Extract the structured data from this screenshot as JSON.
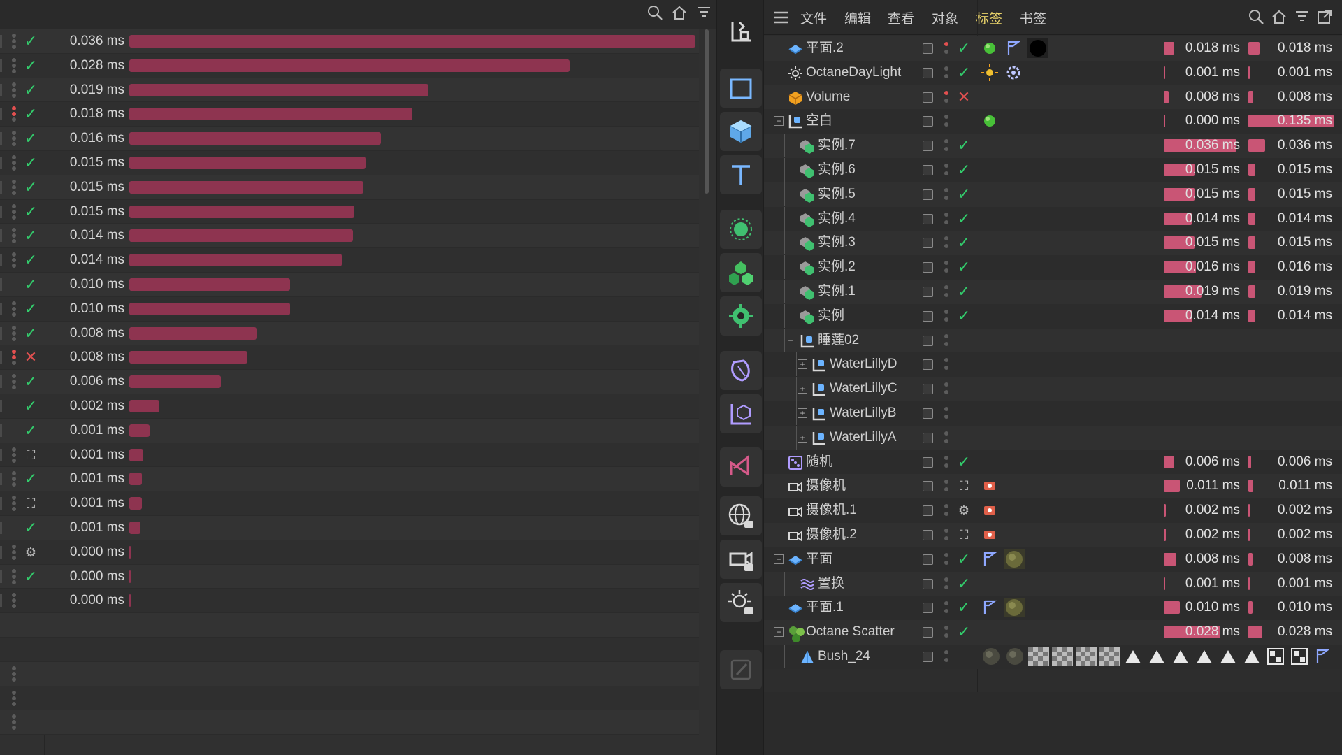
{
  "left": {
    "rows": [
      {
        "ms": "0.036 ms",
        "v": 0.036,
        "status": "check",
        "dots": "normal"
      },
      {
        "ms": "0.028 ms",
        "v": 0.028,
        "status": "check",
        "dots": "normal"
      },
      {
        "ms": "0.019 ms",
        "v": 0.019,
        "status": "check",
        "dots": "normal"
      },
      {
        "ms": "0.018 ms",
        "v": 0.018,
        "status": "check",
        "dots": "red"
      },
      {
        "ms": "0.016 ms",
        "v": 0.016,
        "status": "check",
        "dots": "normal"
      },
      {
        "ms": "0.015 ms",
        "v": 0.015,
        "status": "check",
        "dots": "normal"
      },
      {
        "ms": "0.015 ms",
        "v": 0.0149,
        "status": "check",
        "dots": "normal"
      },
      {
        "ms": "0.015 ms",
        "v": 0.0143,
        "status": "check",
        "dots": "normal"
      },
      {
        "ms": "0.014 ms",
        "v": 0.0142,
        "status": "check",
        "dots": "normal"
      },
      {
        "ms": "0.014 ms",
        "v": 0.0135,
        "status": "check",
        "dots": "normal"
      },
      {
        "ms": "0.010 ms",
        "v": 0.0102,
        "status": "check",
        "dots": "none"
      },
      {
        "ms": "0.010 ms",
        "v": 0.0102,
        "status": "check",
        "dots": "normal"
      },
      {
        "ms": "0.008 ms",
        "v": 0.0081,
        "status": "check",
        "dots": "normal"
      },
      {
        "ms": "0.008 ms",
        "v": 0.0075,
        "status": "x",
        "dots": "red"
      },
      {
        "ms": "0.006 ms",
        "v": 0.0058,
        "status": "check",
        "dots": "normal"
      },
      {
        "ms": "0.002 ms",
        "v": 0.0019,
        "status": "check",
        "dots": "none"
      },
      {
        "ms": "0.001 ms",
        "v": 0.0013,
        "status": "check",
        "dots": "none"
      },
      {
        "ms": "0.001 ms",
        "v": 0.0009,
        "status": "box",
        "dots": "normal"
      },
      {
        "ms": "0.001 ms",
        "v": 0.0008,
        "status": "check",
        "dots": "normal"
      },
      {
        "ms": "0.001 ms",
        "v": 0.0008,
        "status": "box",
        "dots": "normal"
      },
      {
        "ms": "0.001 ms",
        "v": 0.0007,
        "status": "check",
        "dots": "none"
      },
      {
        "ms": "0.000 ms",
        "v": 0.0001,
        "status": "gear",
        "dots": "normal"
      },
      {
        "ms": "0.000 ms",
        "v": 5e-05,
        "status": "check",
        "dots": "normal"
      },
      {
        "ms": "0.000 ms",
        "v": 3e-05,
        "status": "none",
        "dots": "normal"
      }
    ],
    "max": 0.036
  },
  "menu": {
    "file": "文件",
    "edit": "编辑",
    "view": "查看",
    "object": "对象",
    "tags": "标签",
    "bookmarks": "书签"
  },
  "objects": [
    {
      "name": "平面.2",
      "indent": 0,
      "exp": "",
      "icon": "plane",
      "vis": "red",
      "stat": "check",
      "tags": "green,flag,black",
      "t1": "0.018 ms",
      "f1": 0.133,
      "t2": "0.018 ms",
      "f2": 0.133
    },
    {
      "name": "OctaneDayLight",
      "indent": 0,
      "exp": "",
      "icon": "sun",
      "vis": "normal",
      "stat": "check",
      "tags": "sun,gear",
      "t1": "0.001 ms",
      "f1": 0.0,
      "t2": "0.001 ms",
      "f2": 0.0
    },
    {
      "name": "Volume",
      "indent": 0,
      "exp": "",
      "icon": "volume",
      "vis": "red",
      "stat": "x",
      "tags": "",
      "t1": "0.008 ms",
      "f1": 0.06,
      "t2": "0.008 ms",
      "f2": 0.06
    },
    {
      "name": "空白",
      "indent": 0,
      "exp": "-",
      "icon": "null",
      "vis": "normal",
      "stat": "none",
      "tags": "green",
      "t1": "0.000 ms",
      "f1": 0.0,
      "t2": "0.135 ms",
      "f2": 1.0
    },
    {
      "name": "实例.7",
      "indent": 1,
      "exp": "",
      "icon": "instance",
      "vis": "normal",
      "stat": "check",
      "tags": "",
      "t1": "0.036 ms",
      "f1": 0.9,
      "t2": "0.036 ms",
      "f2": 0.2
    },
    {
      "name": "实例.6",
      "indent": 1,
      "exp": "",
      "icon": "instance",
      "vis": "normal",
      "stat": "check",
      "tags": "",
      "t1": "0.015 ms",
      "f1": 0.38,
      "t2": "0.015 ms",
      "f2": 0.08
    },
    {
      "name": "实例.5",
      "indent": 1,
      "exp": "",
      "icon": "instance",
      "vis": "normal",
      "stat": "check",
      "tags": "",
      "t1": "0.015 ms",
      "f1": 0.38,
      "t2": "0.015 ms",
      "f2": 0.08
    },
    {
      "name": "实例.4",
      "indent": 1,
      "exp": "",
      "icon": "instance",
      "vis": "normal",
      "stat": "check",
      "tags": "",
      "t1": "0.014 ms",
      "f1": 0.35,
      "t2": "0.014 ms",
      "f2": 0.08
    },
    {
      "name": "实例.3",
      "indent": 1,
      "exp": "",
      "icon": "instance",
      "vis": "normal",
      "stat": "check",
      "tags": "",
      "t1": "0.015 ms",
      "f1": 0.38,
      "t2": "0.015 ms",
      "f2": 0.08
    },
    {
      "name": "实例.2",
      "indent": 1,
      "exp": "",
      "icon": "instance",
      "vis": "normal",
      "stat": "check",
      "tags": "",
      "t1": "0.016 ms",
      "f1": 0.4,
      "t2": "0.016 ms",
      "f2": 0.08
    },
    {
      "name": "实例.1",
      "indent": 1,
      "exp": "",
      "icon": "instance",
      "vis": "normal",
      "stat": "check",
      "tags": "",
      "t1": "0.019 ms",
      "f1": 0.47,
      "t2": "0.019 ms",
      "f2": 0.08
    },
    {
      "name": "实例",
      "indent": 1,
      "exp": "",
      "icon": "instance",
      "vis": "normal",
      "stat": "check",
      "tags": "",
      "t1": "0.014 ms",
      "f1": 0.35,
      "t2": "0.014 ms",
      "f2": 0.08
    },
    {
      "name": "睡莲02",
      "indent": 1,
      "exp": "-",
      "icon": "null",
      "vis": "normal",
      "stat": "none",
      "tags": "",
      "t1": "",
      "f1": 0,
      "t2": "",
      "f2": 0
    },
    {
      "name": "WaterLillyD",
      "indent": 2,
      "exp": "+",
      "icon": "null",
      "vis": "normal",
      "stat": "none",
      "tags": "",
      "t1": "",
      "f1": 0,
      "t2": "",
      "f2": 0
    },
    {
      "name": "WaterLillyC",
      "indent": 2,
      "exp": "+",
      "icon": "null",
      "vis": "normal",
      "stat": "none",
      "tags": "",
      "t1": "",
      "f1": 0,
      "t2": "",
      "f2": 0
    },
    {
      "name": "WaterLillyB",
      "indent": 2,
      "exp": "+",
      "icon": "null",
      "vis": "normal",
      "stat": "none",
      "tags": "",
      "t1": "",
      "f1": 0,
      "t2": "",
      "f2": 0
    },
    {
      "name": "WaterLillyA",
      "indent": 2,
      "exp": "+",
      "icon": "null",
      "vis": "normal",
      "stat": "none",
      "tags": "",
      "t1": "",
      "f1": 0,
      "t2": "",
      "f2": 0
    },
    {
      "name": "随机",
      "indent": 0,
      "exp": "",
      "icon": "random",
      "vis": "normal",
      "stat": "check",
      "tags": "",
      "t1": "0.006 ms",
      "f1": 0.13,
      "t2": "0.006 ms",
      "f2": 0.03
    },
    {
      "name": "摄像机",
      "indent": 0,
      "exp": "",
      "icon": "camera",
      "vis": "normal",
      "stat": "box",
      "tags": "cam",
      "t1": "0.011 ms",
      "f1": 0.2,
      "t2": "0.011 ms",
      "f2": 0.06
    },
    {
      "name": "摄像机.1",
      "indent": 0,
      "exp": "",
      "icon": "camera",
      "vis": "normal",
      "stat": "gear",
      "tags": "cam",
      "t1": "0.002 ms",
      "f1": 0.03,
      "t2": "0.002 ms",
      "f2": 0.0
    },
    {
      "name": "摄像机.2",
      "indent": 0,
      "exp": "",
      "icon": "camera",
      "vis": "normal",
      "stat": "box",
      "tags": "cam",
      "t1": "0.002 ms",
      "f1": 0.03,
      "t2": "0.002 ms",
      "f2": 0.0
    },
    {
      "name": "平面",
      "indent": 0,
      "exp": "-",
      "icon": "plane",
      "vis": "normal",
      "stat": "check",
      "tags": "flag,moss",
      "t1": "0.008 ms",
      "f1": 0.16,
      "t2": "0.008 ms",
      "f2": 0.05
    },
    {
      "name": "置换",
      "indent": 1,
      "exp": "",
      "icon": "displace",
      "vis": "normal",
      "stat": "check",
      "tags": "",
      "t1": "0.001 ms",
      "f1": 0.0,
      "t2": "0.001 ms",
      "f2": 0.0
    },
    {
      "name": "平面.1",
      "indent": 0,
      "exp": "",
      "icon": "plane",
      "vis": "normal",
      "stat": "check",
      "tags": "flag,moss2",
      "t1": "0.010 ms",
      "f1": 0.2,
      "t2": "0.010 ms",
      "f2": 0.05
    },
    {
      "name": "Octane Scatter",
      "indent": 0,
      "exp": "-",
      "icon": "scatter",
      "vis": "normal",
      "stat": "check",
      "tags": "",
      "t1": "0.028 ms",
      "f1": 0.7,
      "t2": "0.028 ms",
      "f2": 0.16
    },
    {
      "name": "Bush_24",
      "indent": 1,
      "exp": "",
      "icon": "bush",
      "vis": "normal",
      "stat": "none",
      "tags": "bush",
      "t1": "",
      "f1": 0,
      "t2": "",
      "f2": 0
    }
  ],
  "colors": {
    "bar": "#8e3450",
    "tbar": "#c95575",
    "check": "#33cc6c",
    "x": "#e05050",
    "tagsActive": "#e8d26a"
  }
}
